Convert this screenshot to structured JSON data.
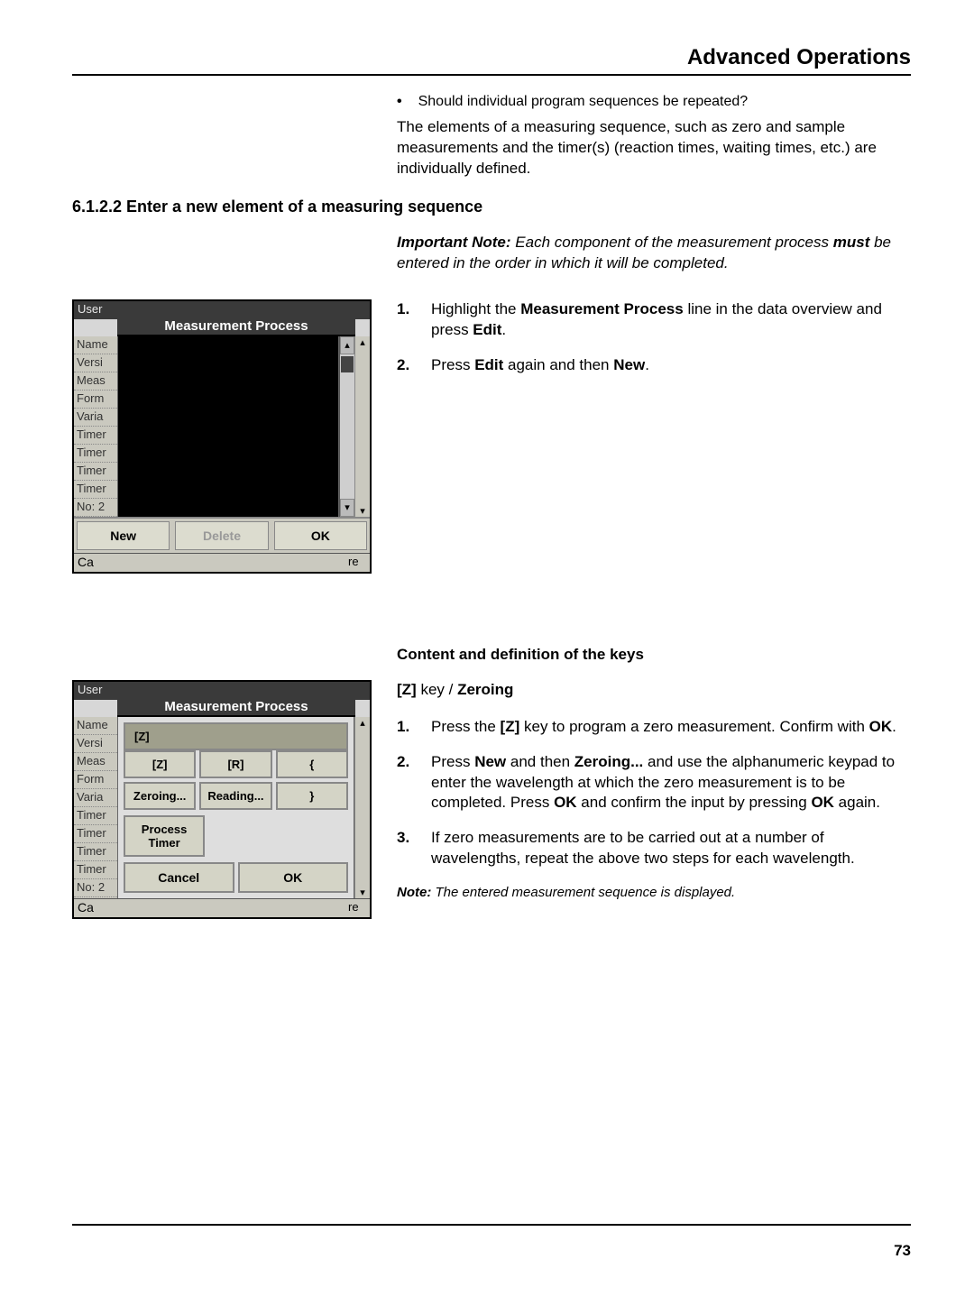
{
  "header": {
    "title": "Advanced Operations"
  },
  "intro": {
    "bullet": "Should individual program sequences be repeated?",
    "para": "The elements of a measuring sequence, such as zero and sample measurements and the timer(s) (reaction times, waiting times, etc.) are individually defined."
  },
  "section_heading": "6.1.2.2  Enter a new element of a measuring sequence",
  "note": {
    "prefix": "Important Note:",
    "text1": " Each component of the measurement process ",
    "must": "must",
    "text2": " be entered in the order in which it will be completed."
  },
  "block1": {
    "steps": [
      {
        "num": "1.",
        "pre": "Highlight the ",
        "b1": "Measurement Process",
        "mid": " line in the data overview and press ",
        "b2": "Edit",
        "post": "."
      },
      {
        "num": "2.",
        "pre": "Press ",
        "b1": "Edit",
        "mid": " again and then ",
        "b2": "New",
        "post": "."
      }
    ]
  },
  "content_keys_heading": "Content and definition of the keys",
  "block2": {
    "key_heading_pre": "[Z]",
    "key_heading_mid": " key / ",
    "key_heading_b": "Zeroing",
    "steps": [
      {
        "num": "1.",
        "text_pre": "Press the ",
        "b1": "[Z]",
        "text_mid": " key to program a zero measurement. Confirm with ",
        "b2": "OK",
        "text_post": "."
      },
      {
        "num": "2.",
        "text_pre": "Press ",
        "b1": "New",
        "text_mid": " and then ",
        "b2": "Zeroing...",
        "text_mid2": " and use the alphanumeric keypad to enter the wavelength at which the zero measurement is to be completed. Press ",
        "b3": "OK",
        "text_mid3": " and confirm the input by pressing ",
        "b4": "OK",
        "text_post": " again."
      },
      {
        "num": "3.",
        "text_pre": "If zero measurements are to be carried out at a number of wavelengths, repeat the above two steps for each wavelength."
      }
    ],
    "footnote_prefix": "Note:",
    "footnote": " The entered measurement sequence is displayed."
  },
  "dialog1": {
    "user": "User",
    "title": "Measurement Process",
    "sidebar": [
      "Name",
      "Versi",
      "Meas",
      "Form",
      "Varia",
      "Timer",
      "Timer",
      "Timer",
      "Timer",
      "No: 2"
    ],
    "buttons": {
      "new": "New",
      "delete": "Delete",
      "ok": "OK"
    },
    "ca": "Ca",
    "re": "re"
  },
  "dialog2": {
    "user": "User",
    "title": "Measurement Process",
    "sidebar": [
      "Name",
      "Versi",
      "Meas",
      "Form",
      "Varia",
      "Timer",
      "Timer",
      "Timer",
      "Timer",
      "No: 2"
    ],
    "z_wide": "[Z]",
    "keys_row1": [
      "[Z]",
      "[R]",
      "{"
    ],
    "keys_row2": [
      "Zeroing...",
      "Reading...",
      "}"
    ],
    "process_timer": "Process Timer",
    "buttons": {
      "cancel": "Cancel",
      "ok": "OK"
    },
    "ca": "Ca",
    "re": "re"
  },
  "page_number": "73"
}
